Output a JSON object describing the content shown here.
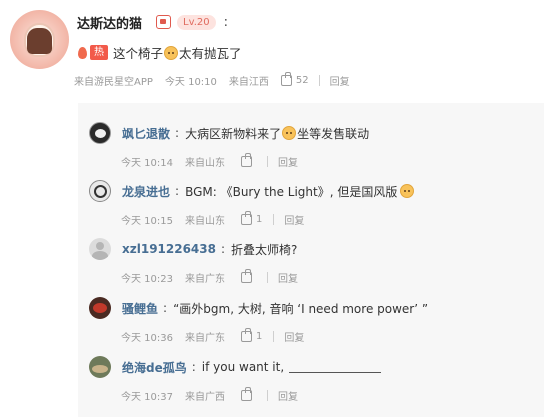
{
  "comment": {
    "author": "达斯达的猫",
    "level": "Lv.20",
    "colon": ":",
    "hot_tag": "热",
    "text_before_emoji": "这个椅子",
    "text_after_emoji": "太有抛瓦了",
    "source": "来自游民星空APP",
    "time": "今天 10:10",
    "location": "来自江西",
    "likes": "52",
    "reply_label": "回复"
  },
  "replies": [
    {
      "name": "飒匕退散",
      "colon": ":",
      "text": "大病区新物料来了",
      "text_after_emoji": "坐等发售联动",
      "time": "今天 10:14",
      "location": "来自山东",
      "likes": "",
      "reply_label": "回复"
    },
    {
      "name": "龙泉进也",
      "colon": ":",
      "text": "BGM: 《Bury the Light》, 但是国风版",
      "time": "今天 10:15",
      "location": "来自山东",
      "likes": "1",
      "reply_label": "回复"
    },
    {
      "name": "xzl191226438",
      "colon": ":",
      "text": "折叠太师椅?",
      "time": "今天 10:23",
      "location": "来自广东",
      "likes": "",
      "reply_label": "回复"
    },
    {
      "name": "骚鲤鱼",
      "colon": ":",
      "text": "“画外bgm, 大树, 音响 ‘I need more power’ ”",
      "time": "今天 10:36",
      "location": "来自广东",
      "likes": "1",
      "reply_label": "回复"
    },
    {
      "name": "绝海de孤鸟",
      "colon": ":",
      "text": "if you want it,",
      "time": "今天 10:37",
      "location": "来自广西",
      "likes": "",
      "reply_label": "回复"
    }
  ],
  "colors": {
    "reply_name": "#476e93",
    "hot_tag": "#f25a4a",
    "level_bg": "#fde3df",
    "replies_bg": "#f7f7f7"
  },
  "icons": [
    "fire-icon",
    "thumbs-up-icon",
    "emoji-icon",
    "badge-icon"
  ]
}
